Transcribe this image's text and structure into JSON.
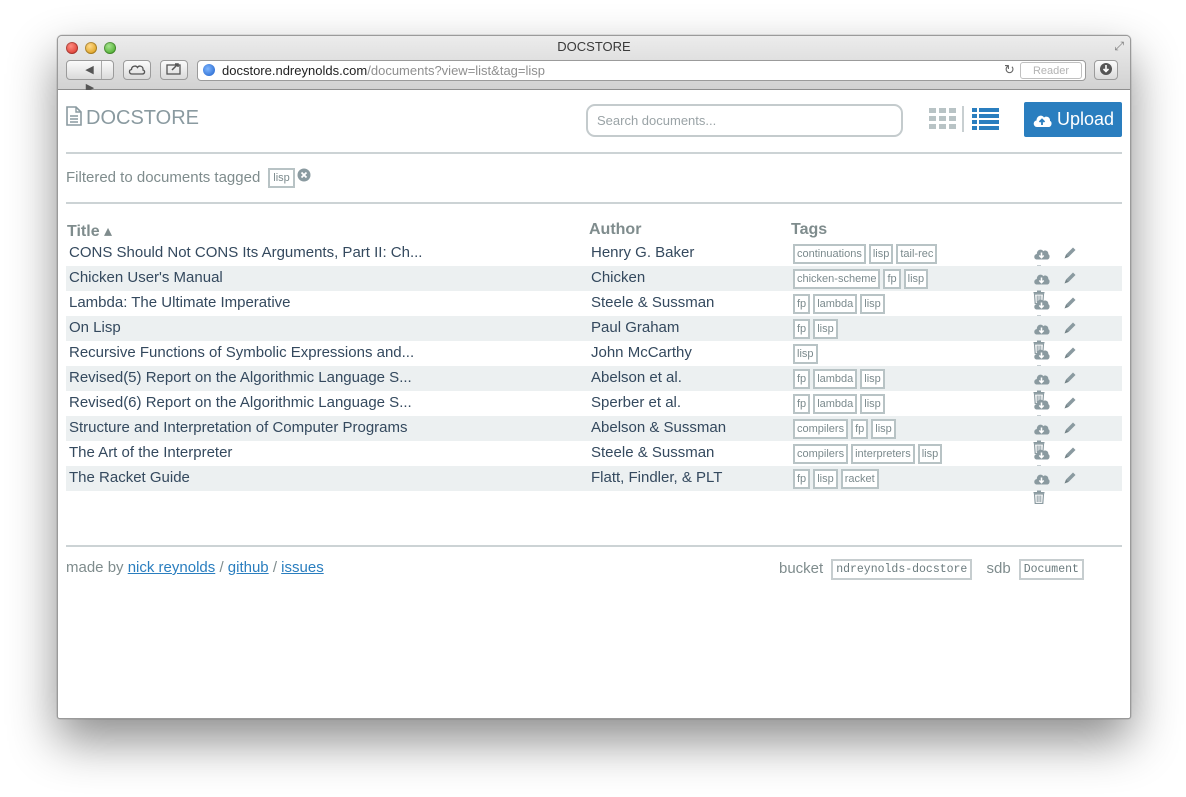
{
  "window": {
    "title": "DOCSTORE"
  },
  "browser": {
    "url_host": "docstore.ndreynolds.com",
    "url_rest": "/documents?view=list&tag=lisp",
    "reader_label": "Reader"
  },
  "header": {
    "logo": "DOCSTORE",
    "search_placeholder": "Search documents...",
    "upload_label": "Upload"
  },
  "filter": {
    "text": "Filtered to documents tagged",
    "tag": "lisp"
  },
  "table": {
    "columns": {
      "title": "Title ▴",
      "author": "Author",
      "tags": "Tags"
    },
    "documents": [
      {
        "title": "CONS Should Not CONS Its Arguments, Part II: Ch...",
        "author": "Henry G. Baker",
        "tags": [
          "continuations",
          "lisp",
          "tail-rec"
        ]
      },
      {
        "title": "Chicken User's Manual",
        "author": "Chicken",
        "tags": [
          "chicken-scheme",
          "fp",
          "lisp"
        ]
      },
      {
        "title": "Lambda: The Ultimate Imperative",
        "author": "Steele & Sussman",
        "tags": [
          "fp",
          "lambda",
          "lisp"
        ]
      },
      {
        "title": "On Lisp",
        "author": "Paul Graham",
        "tags": [
          "fp",
          "lisp"
        ]
      },
      {
        "title": "Recursive Functions of Symbolic Expressions and...",
        "author": "John McCarthy",
        "tags": [
          "lisp"
        ]
      },
      {
        "title": "Revised(5) Report on the Algorithmic Language S...",
        "author": "Abelson et al.",
        "tags": [
          "fp",
          "lambda",
          "lisp"
        ]
      },
      {
        "title": "Revised(6) Report on the Algorithmic Language S...",
        "author": "Sperber et al.",
        "tags": [
          "fp",
          "lambda",
          "lisp"
        ]
      },
      {
        "title": "Structure and Interpretation of Computer Programs",
        "author": "Abelson & Sussman",
        "tags": [
          "compilers",
          "fp",
          "lisp"
        ]
      },
      {
        "title": "The Art of the Interpreter",
        "author": "Steele & Sussman",
        "tags": [
          "compilers",
          "interpreters",
          "lisp"
        ]
      },
      {
        "title": "The Racket Guide",
        "author": "Flatt, Findler, & PLT",
        "tags": [
          "fp",
          "lisp",
          "racket"
        ]
      }
    ]
  },
  "footer": {
    "made_by": "made by",
    "author_link": "nick reynolds",
    "sep": "/",
    "github_link": "github",
    "issues_link": "issues",
    "bucket_label": "bucket",
    "bucket_value": "ndreynolds-docstore",
    "sdb_label": "sdb",
    "sdb_value": "Document"
  },
  "colors": {
    "accent": "#2a7ebf",
    "text": "#34495e",
    "muted": "#7f8c8d",
    "row_alt": "#ecf0f1"
  },
  "icons": [
    "document-icon",
    "grid-view-icon",
    "list-view-icon",
    "cloud-upload-icon",
    "remove-tag-icon",
    "cloud-download-icon",
    "pencil-icon",
    "trash-icon"
  ]
}
